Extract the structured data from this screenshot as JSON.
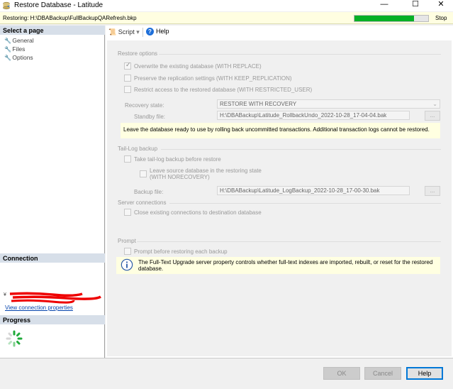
{
  "window": {
    "title": "Restore Database - Latitude",
    "min_glyph": "—",
    "max_glyph": "☐",
    "close_glyph": "✕"
  },
  "status": {
    "restoring": "Restoring: H:\\DBABackup\\FullBackupQARefresh.bkp",
    "progress_fraction": 0.81,
    "stop_label": "Stop",
    "progress_color": "#06b025"
  },
  "left": {
    "select_page_title": "Select a page",
    "pages": [
      "General",
      "Files",
      "Options"
    ],
    "connection_title": "Connection",
    "view_connection_properties": "View connection properties",
    "progress_title": "Progress"
  },
  "toolbar": {
    "script": "Script",
    "dropdown": "▾",
    "help": "Help",
    "help_glyph": "?"
  },
  "options": {
    "restore_group": "Restore options",
    "overwrite": "Overwrite the existing database (WITH REPLACE)",
    "preserve": "Preserve the replication settings (WITH KEEP_REPLICATION)",
    "restrict": "Restrict access to the restored database (WITH RESTRICTED_USER)",
    "recovery_state_label": "Recovery state:",
    "recovery_state_value": "RESTORE WITH RECOVERY",
    "standby_label": "Standby file:",
    "standby_value": "H:\\DBABackup\\Latitude_RollbackUndo_2022-10-28_17-04-04.bak",
    "browse": "...",
    "recovery_info": "Leave the database ready to use by rolling back uncommitted transactions. Additional transaction logs cannot be restored.",
    "taillog_group": "Tail-Log backup",
    "take_taillog": "Take tail-log backup before restore",
    "leave_source_1": "Leave source database in the restoring state",
    "leave_source_2": "(WITH NORECOVERY)",
    "backup_file_label": "Backup file:",
    "backup_file_value": "H:\\DBABackup\\Latitude_LogBackup_2022-10-28_17-00-30.bak",
    "server_conn_group": "Server connections",
    "close_conns": "Close existing connections to destination database",
    "prompt_group": "Prompt",
    "prompt_each": "Prompt before restoring each backup",
    "fulltext_info_1": "The Full-Text Upgrade server property controls whether full-text indexes are imported, rebuilt, or reset for the restored",
    "fulltext_info_2": "database."
  },
  "buttons": {
    "ok": "OK",
    "cancel": "Cancel",
    "help": "Help"
  }
}
